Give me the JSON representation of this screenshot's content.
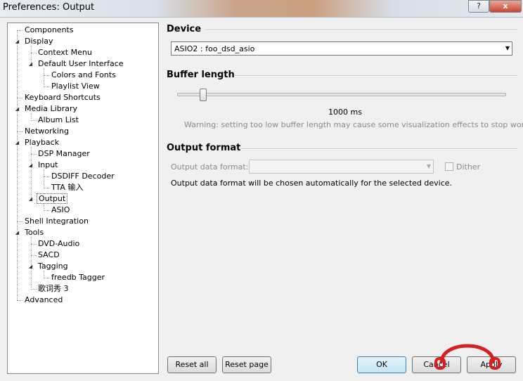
{
  "window": {
    "title": "Preferences: Output",
    "help_label": "?",
    "close_label": "x"
  },
  "tree": {
    "items": [
      "Components",
      "Display",
      "Context Menu",
      "Default User Interface",
      "Colors and Fonts",
      "Playlist View",
      "Keyboard Shortcuts",
      "Media Library",
      "Album List",
      "Networking",
      "Playback",
      "DSP Manager",
      "Input",
      "DSDIFF Decoder",
      "TTA 输入",
      "Output",
      "ASIO",
      "Shell Integration",
      "Tools",
      "DVD-Audio",
      "SACD",
      "Tagging",
      "freedb Tagger",
      "歌词秀 3",
      "Advanced"
    ],
    "selected": "Output"
  },
  "device": {
    "title": "Device",
    "selected": "ASIO2 : foo_dsd_asio"
  },
  "buffer": {
    "title": "Buffer length",
    "value_label": "1000 ms",
    "position": 0.07,
    "warning": "Warning: setting too low buffer length may cause some visualization effects to stop working."
  },
  "output_format": {
    "title": "Output format",
    "label": "Output data format:",
    "selected": "",
    "dither_label": "Dither",
    "info": "Output data format will be chosen automatically for the selected device."
  },
  "buttons": {
    "reset_all": "Reset all",
    "reset_page": "Reset page",
    "ok": "OK",
    "cancel": "Cancel",
    "apply": "Apply"
  },
  "colors": {
    "accent_default": "#3c7fb1",
    "selection_border": "#555555",
    "watermark_red": "#d42020"
  }
}
